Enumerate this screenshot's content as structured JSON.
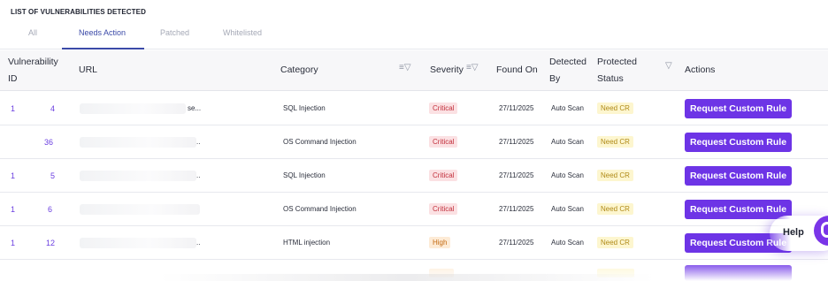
{
  "section_title": "LIST OF VULNERABILITIES DETECTED",
  "tabs": [
    {
      "label": "All",
      "active": false
    },
    {
      "label": "Needs Action",
      "active": true
    },
    {
      "label": "Patched",
      "active": false
    },
    {
      "label": "Whitelisted",
      "active": false
    }
  ],
  "columns": {
    "vuln_id_line1": "Vulnerability",
    "vuln_id_line2": "ID",
    "url": "URL",
    "category": "Category",
    "severity": "Severity",
    "found_on": "Found On",
    "detected_line1": "Detected",
    "detected_line2": "By",
    "protected_line1": "Protected",
    "protected_line2": "Status",
    "actions": "Actions"
  },
  "rows": [
    {
      "id_start": "1",
      "id_end": "4",
      "url_tail": "se...",
      "category": "SQL Injection",
      "severity": "Critical",
      "found_on": "27/11/2025",
      "detected_by": "Auto Scan",
      "protected_status": "Need CR",
      "action": "Request Custom Rule"
    },
    {
      "id_start": "",
      "id_end": "36",
      "url_tail": "..",
      "category": "OS Command Injection",
      "severity": "Critical",
      "found_on": "27/11/2025",
      "detected_by": "Auto Scan",
      "protected_status": "Need CR",
      "action": "Request Custom Rule"
    },
    {
      "id_start": "1",
      "id_end": "5",
      "url_tail": "..",
      "category": "SQL Injection",
      "severity": "Critical",
      "found_on": "27/11/2025",
      "detected_by": "Auto Scan",
      "protected_status": "Need CR",
      "action": "Request Custom Rule"
    },
    {
      "id_start": "1",
      "id_end": "6",
      "url_tail": "",
      "category": "OS Command Injection",
      "severity": "Critical",
      "found_on": "27/11/2025",
      "detected_by": "Auto Scan",
      "protected_status": "Need CR",
      "action": "Request Custom Rule"
    },
    {
      "id_start": "1",
      "id_end": "12",
      "url_tail": "..",
      "category": "HTML injection",
      "severity": "High",
      "found_on": "27/11/2025",
      "detected_by": "Auto Scan",
      "protected_status": "Need CR",
      "action": "Request Custom Rule"
    }
  ],
  "help": {
    "label": "Help",
    "icon": "chat-bubble-icon"
  },
  "colors": {
    "accent": "#6d34e6",
    "tab_active": "#3b4aa8",
    "critical_bg": "#fbe1e3",
    "critical_fg": "#c2303c",
    "high_bg": "#fdebd6",
    "high_fg": "#c46b13",
    "need_cr_bg": "#fdf6cf",
    "need_cr_fg": "#b08a17"
  }
}
